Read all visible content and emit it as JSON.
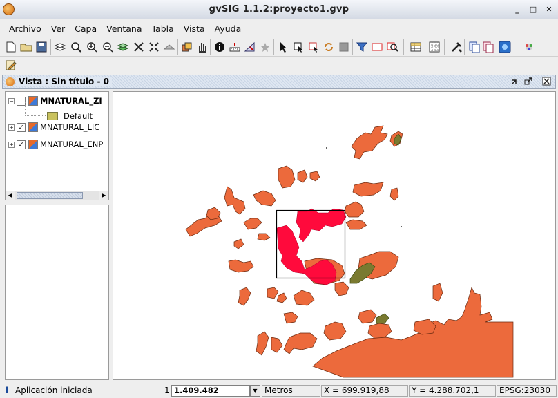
{
  "window": {
    "title": "gvSIG 1.1.2:proyecto1.gvp",
    "minimize": "_",
    "maximize": "□",
    "close": "✕"
  },
  "menu": [
    "Archivo",
    "Ver",
    "Capa",
    "Ventana",
    "Tabla",
    "Vista",
    "Ayuda"
  ],
  "toolbar": {
    "icons": [
      "new-document-icon",
      "open-folder-icon",
      "save-icon",
      "layers-config-icon",
      "zoom-full-icon",
      "zoom-in-icon",
      "zoom-out-icon",
      "zoom-layer-icon",
      "pan-extent-icon",
      "zoom-previous-icon",
      "zoom-window-icon",
      "hand-pan-icon",
      "info-icon",
      "measure-distance-icon",
      "measure-area-icon",
      "select-arrow-icon",
      "select-rect-icon",
      "select-polygon-icon",
      "invert-selection-icon",
      "clear-selection-icon",
      "filter-icon",
      "rectangle-select-icon",
      "locator-icon",
      "table-icon",
      "grid-icon",
      "tools-icon",
      "copy-layer-icon",
      "paste-layer-icon",
      "geo-process-icon",
      "navigate-icon",
      "edit-pencil-icon"
    ]
  },
  "view": {
    "title": "Vista : Sin título - 0"
  },
  "toc": {
    "layers": [
      {
        "name": "MNATURAL_ZI",
        "checked": false,
        "bold": true,
        "expanded": true
      },
      {
        "name": "Default",
        "legend": true,
        "color": "#c9c25e"
      },
      {
        "name": "MNATURAL_LIC",
        "checked": true,
        "bold": false,
        "expanded": false
      },
      {
        "name": "MNATURAL_ENP",
        "checked": true,
        "bold": false,
        "expanded": false
      }
    ]
  },
  "map": {
    "fill_color": "#ec6a3c",
    "selection_color": "#ff0a3c",
    "overlay_color": "#7a7a30"
  },
  "status": {
    "message": "Aplicación iniciada",
    "scale_prefix": "1:",
    "scale_value": "1.409.482",
    "units": "Metros",
    "x_coord": "X = 699.919,88",
    "y_coord": "Y = 4.288.702,1",
    "epsg": "EPSG:23030"
  }
}
